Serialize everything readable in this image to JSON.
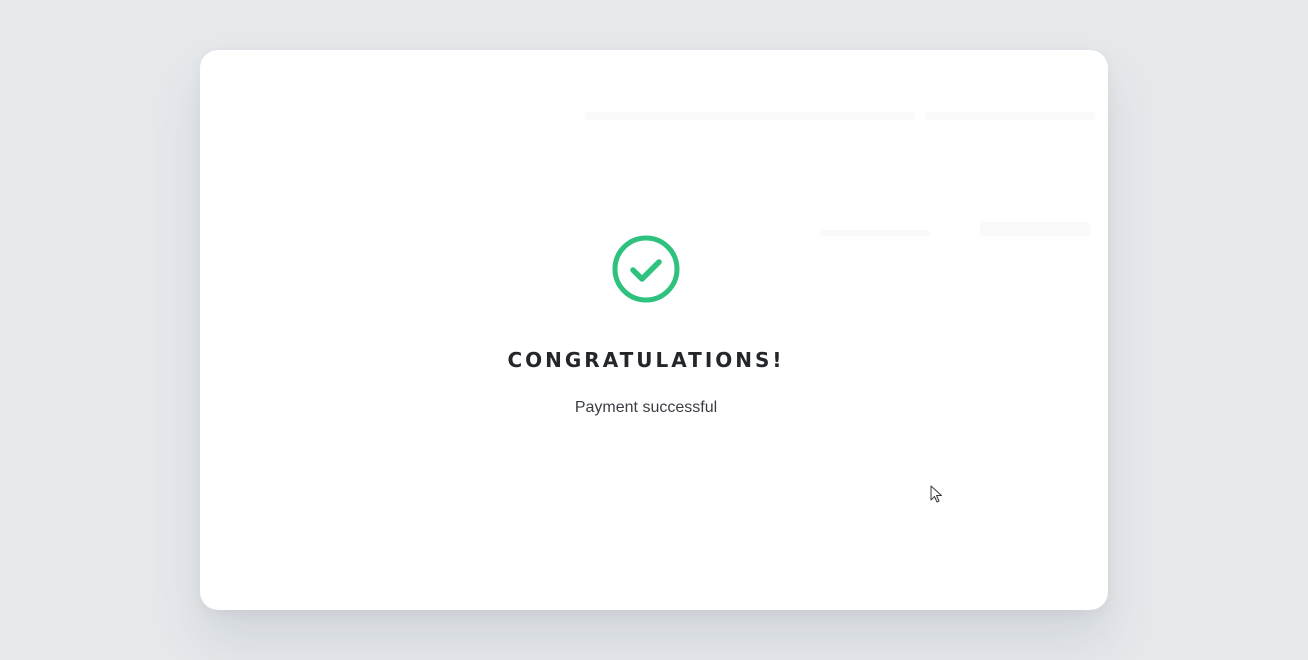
{
  "modal": {
    "title": "CONGRATULATIONS!",
    "message": "Payment successful",
    "icon": "check-circle-icon"
  },
  "colors": {
    "background": "#e6e9ec",
    "card": "#ffffff",
    "success": "#2ec27e",
    "title_text": "#23262b",
    "message_text": "#3a3e44"
  }
}
